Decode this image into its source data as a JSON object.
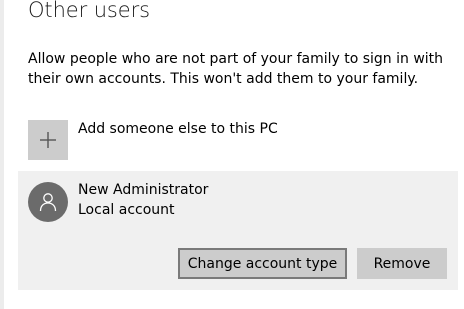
{
  "section": {
    "title": "Other users",
    "description": "Allow people who are not part of your family to sign in with their own accounts. This won't add them to your family."
  },
  "add_user": {
    "label": "Add someone else to this PC",
    "icon": "plus-icon"
  },
  "user": {
    "name": "New Administrator",
    "account_type": "Local account",
    "avatar_icon": "person-icon"
  },
  "actions": {
    "change_account_type_label": "Change account type",
    "remove_label": "Remove"
  },
  "colors": {
    "tile_gray": "#cccccc",
    "panel_bg": "#f0f0f0",
    "avatar_bg": "#6b6b6b"
  }
}
